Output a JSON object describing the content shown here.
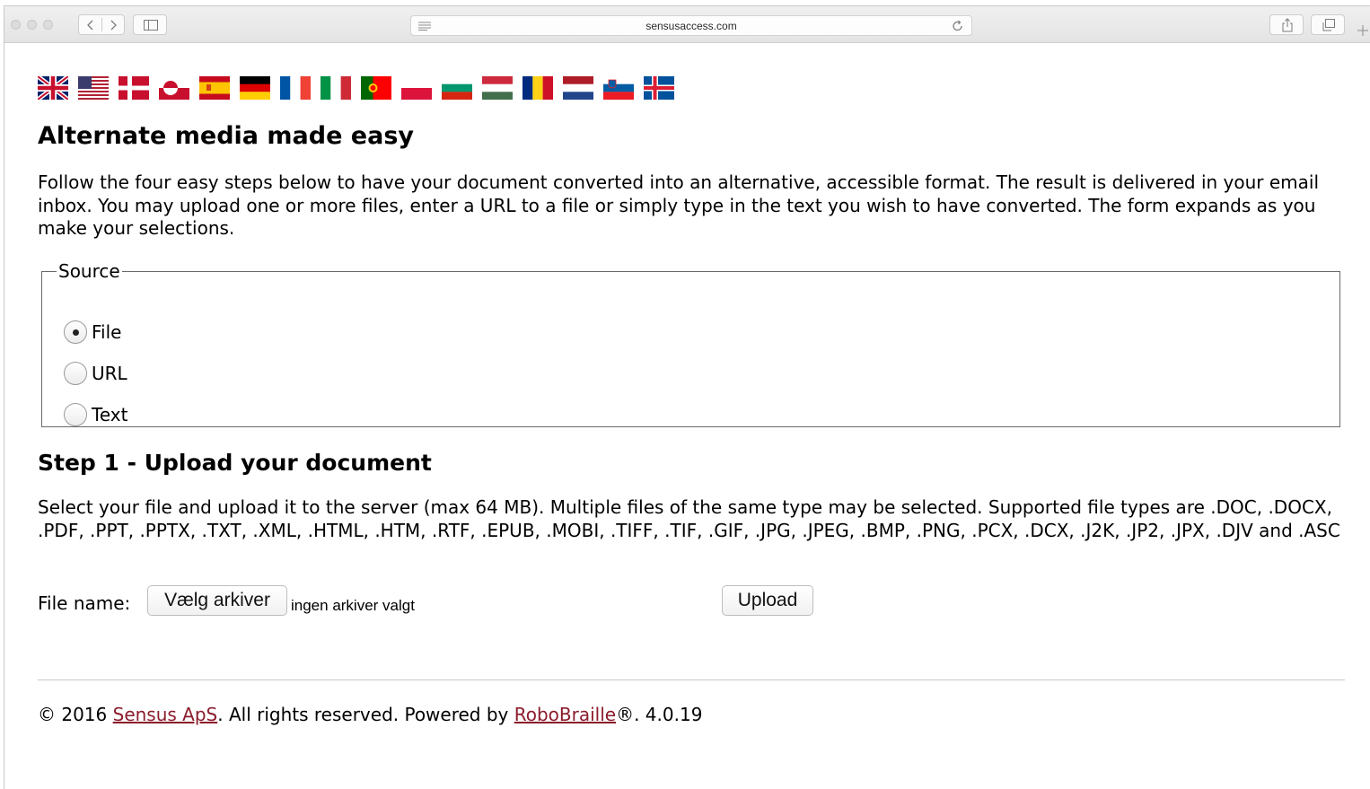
{
  "browser": {
    "url": "sensusaccess.com"
  },
  "languages": [
    {
      "flag": "united-kingdom"
    },
    {
      "flag": "united-states"
    },
    {
      "flag": "denmark"
    },
    {
      "flag": "greenland"
    },
    {
      "flag": "spain"
    },
    {
      "flag": "germany"
    },
    {
      "flag": "france"
    },
    {
      "flag": "italy"
    },
    {
      "flag": "portugal"
    },
    {
      "flag": "poland"
    },
    {
      "flag": "bulgaria"
    },
    {
      "flag": "hungary"
    },
    {
      "flag": "romania"
    },
    {
      "flag": "netherlands"
    },
    {
      "flag": "slovenia"
    },
    {
      "flag": "iceland"
    }
  ],
  "page": {
    "title": "Alternate media made easy",
    "intro": "Follow the four easy steps below to have your document converted into an alternative, accessible format. The result is delivered in your email inbox. You may upload one or more files, enter a URL to a file or simply type in the text you wish to have converted. The form expands as you make your selections."
  },
  "source": {
    "legend": "Source",
    "options": [
      {
        "label": "File",
        "checked": true
      },
      {
        "label": "URL",
        "checked": false
      },
      {
        "label": "Text",
        "checked": false
      }
    ]
  },
  "step1": {
    "title": "Step 1 - Upload your document",
    "description": "Select your file and upload it to the server (max 64 MB). Multiple files of the same type may be selected. Supported file types are .DOC, .DOCX, .PDF, .PPT, .PPTX, .TXT, .XML, .HTML, .HTM, .RTF, .EPUB, .MOBI, .TIFF, .TIF, .GIF, .JPG, .JPEG, .BMP, .PNG, .PCX, .DCX, .J2K, .JP2, .JPX, .DJV and .ASC",
    "file_label": "File name:",
    "choose_button": "Vælg arkiver",
    "no_file_text": "ingen arkiver valgt",
    "upload_button": "Upload"
  },
  "footer": {
    "prefix": "© 2016 ",
    "company_link": "Sensus ApS",
    "middle": ". All rights reserved. Powered by ",
    "robobraille_link": "RoboBraille",
    "suffix": "®. 4.0.19"
  },
  "colors": {
    "link": "#8b1c2c"
  }
}
